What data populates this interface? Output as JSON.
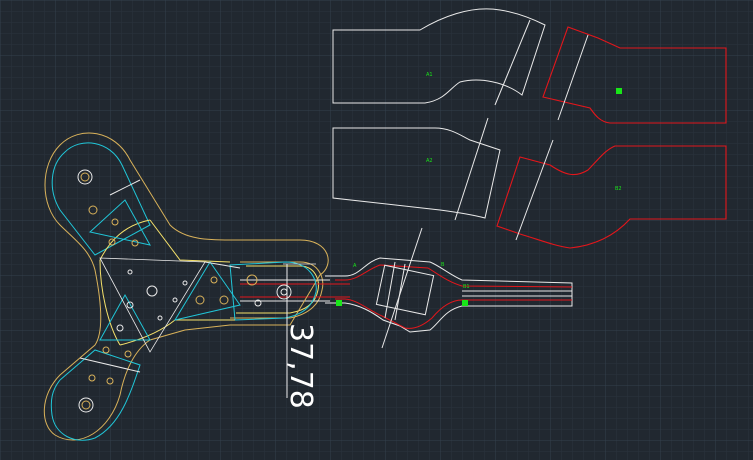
{
  "viewport": {
    "background": "#212830",
    "grid_color": "#2c3440",
    "grid_major_color": "#323b47"
  },
  "colors": {
    "white": "#e9e9e9",
    "red": "#e4161b",
    "cyan": "#21c6d8",
    "yellow": "#f5e16a",
    "orange": "#d9b25a",
    "green": "#19e619",
    "grey": "#9aa0a6"
  },
  "dimension": {
    "value": "37,78"
  },
  "part_labels": {
    "upper_white": "A1",
    "lower_white": "A2",
    "lower_red": "B2",
    "arm_a": "A",
    "arm_b": "B",
    "arm_b1": "B1"
  },
  "icons": {
    "grip": "green-grip-square"
  }
}
